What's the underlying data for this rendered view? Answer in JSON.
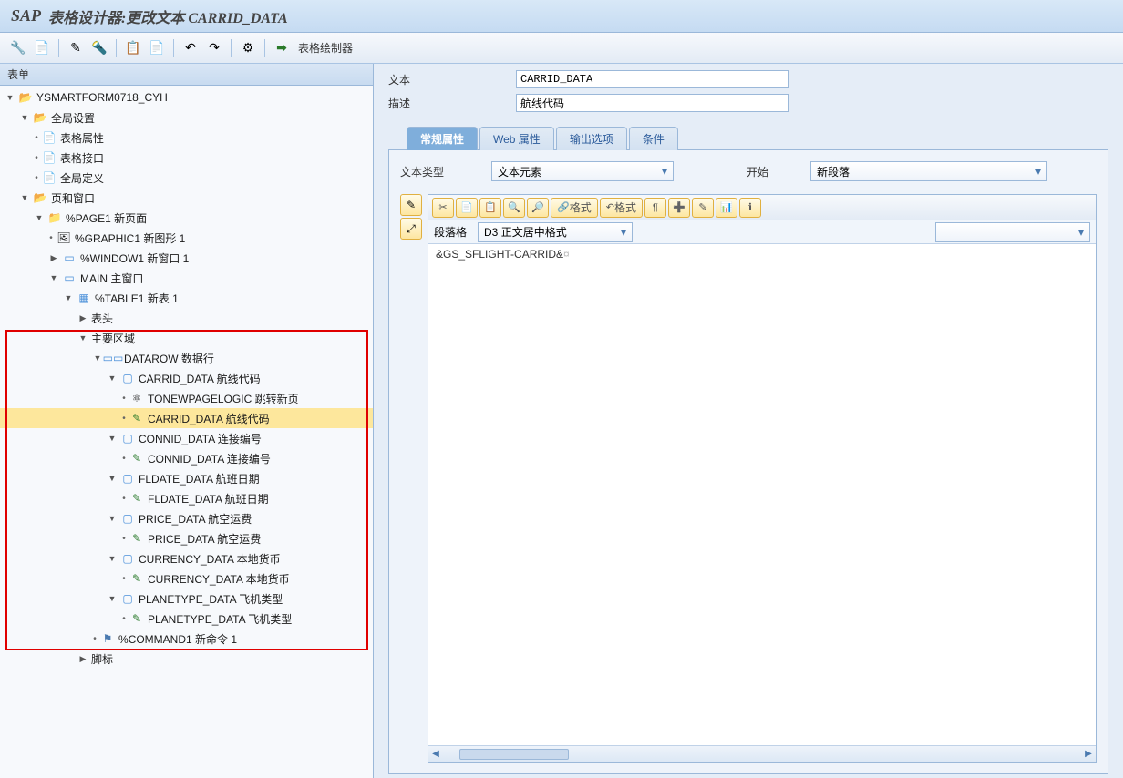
{
  "title": {
    "logo": "SAP",
    "text": "表格设计器:更改文本 CARRID_DATA"
  },
  "toolbar": {
    "painter_label": "表格绘制器"
  },
  "tree": {
    "header": "表单",
    "items": [
      {
        "indent": 0,
        "exp": "▼",
        "icon": "folder-open",
        "label": "YSMARTFORM0718_CYH"
      },
      {
        "indent": 1,
        "exp": "▼",
        "icon": "folder-open",
        "label": "全局设置"
      },
      {
        "indent": 2,
        "bullet": true,
        "icon": "page",
        "label": "表格属性"
      },
      {
        "indent": 2,
        "bullet": true,
        "icon": "page",
        "label": "表格接口"
      },
      {
        "indent": 2,
        "bullet": true,
        "icon": "page",
        "label": "全局定义"
      },
      {
        "indent": 1,
        "exp": "▼",
        "icon": "folder-open",
        "label": "页和窗口"
      },
      {
        "indent": 2,
        "exp": "▼",
        "icon": "folder",
        "label": "%PAGE1 新页面"
      },
      {
        "indent": 3,
        "bullet": true,
        "icon": "graphic",
        "label": "%GRAPHIC1 新图形 1"
      },
      {
        "indent": 3,
        "exp": "▶",
        "icon": "window",
        "label": "%WINDOW1 新窗口 1"
      },
      {
        "indent": 3,
        "exp": "▼",
        "icon": "window",
        "label": "MAIN 主窗口"
      },
      {
        "indent": 4,
        "exp": "▼",
        "icon": "table",
        "label": "%TABLE1 新表 1"
      },
      {
        "indent": 5,
        "exp": "▶",
        "label": "表头"
      },
      {
        "indent": 5,
        "exp": "▼",
        "label": "主要区域"
      },
      {
        "indent": 6,
        "exp": "▼",
        "icon": "row",
        "label": "DATAROW 数据行"
      },
      {
        "indent": 7,
        "exp": "▼",
        "icon": "cell",
        "label": "CARRID_DATA 航线代码"
      },
      {
        "indent": 8,
        "bullet": true,
        "icon": "logic",
        "label": "TONEWPAGELOGIC 跳转新页"
      },
      {
        "indent": 8,
        "bullet": true,
        "icon": "text",
        "label": "CARRID_DATA 航线代码",
        "selected": true
      },
      {
        "indent": 7,
        "exp": "▼",
        "icon": "cell",
        "label": "CONNID_DATA 连接编号"
      },
      {
        "indent": 8,
        "bullet": true,
        "icon": "text",
        "label": "CONNID_DATA 连接编号"
      },
      {
        "indent": 7,
        "exp": "▼",
        "icon": "cell",
        "label": "FLDATE_DATA 航班日期"
      },
      {
        "indent": 8,
        "bullet": true,
        "icon": "text",
        "label": "FLDATE_DATA 航班日期"
      },
      {
        "indent": 7,
        "exp": "▼",
        "icon": "cell",
        "label": "PRICE_DATA 航空运费"
      },
      {
        "indent": 8,
        "bullet": true,
        "icon": "text",
        "label": "PRICE_DATA 航空运费"
      },
      {
        "indent": 7,
        "exp": "▼",
        "icon": "cell",
        "label": "CURRENCY_DATA 本地货币"
      },
      {
        "indent": 8,
        "bullet": true,
        "icon": "text",
        "label": "CURRENCY_DATA 本地货币"
      },
      {
        "indent": 7,
        "exp": "▼",
        "icon": "cell",
        "label": "PLANETYPE_DATA 飞机类型"
      },
      {
        "indent": 8,
        "bullet": true,
        "icon": "text",
        "label": "PLANETYPE_DATA 飞机类型"
      },
      {
        "indent": 6,
        "bullet": true,
        "icon": "cmd",
        "label": "%COMMAND1 新命令 1"
      },
      {
        "indent": 5,
        "exp": "▶",
        "label": "脚标"
      }
    ]
  },
  "right": {
    "text_label": "文本",
    "text_value": "CARRID_DATA",
    "desc_label": "描述",
    "desc_value": "航线代码",
    "tabs": [
      "常规属性",
      "Web 属性",
      "输出选项",
      "条件"
    ],
    "active_tab": 0,
    "type_label": "文本类型",
    "type_value": "文本元素",
    "start_label": "开始",
    "start_value": "新段落",
    "para_label": "段落格",
    "para_value": "D3 正文居中格式",
    "format_btn_1": "格式",
    "format_btn_2": "格式",
    "editor_content": "&GS_SFLIGHT-CARRID&"
  }
}
